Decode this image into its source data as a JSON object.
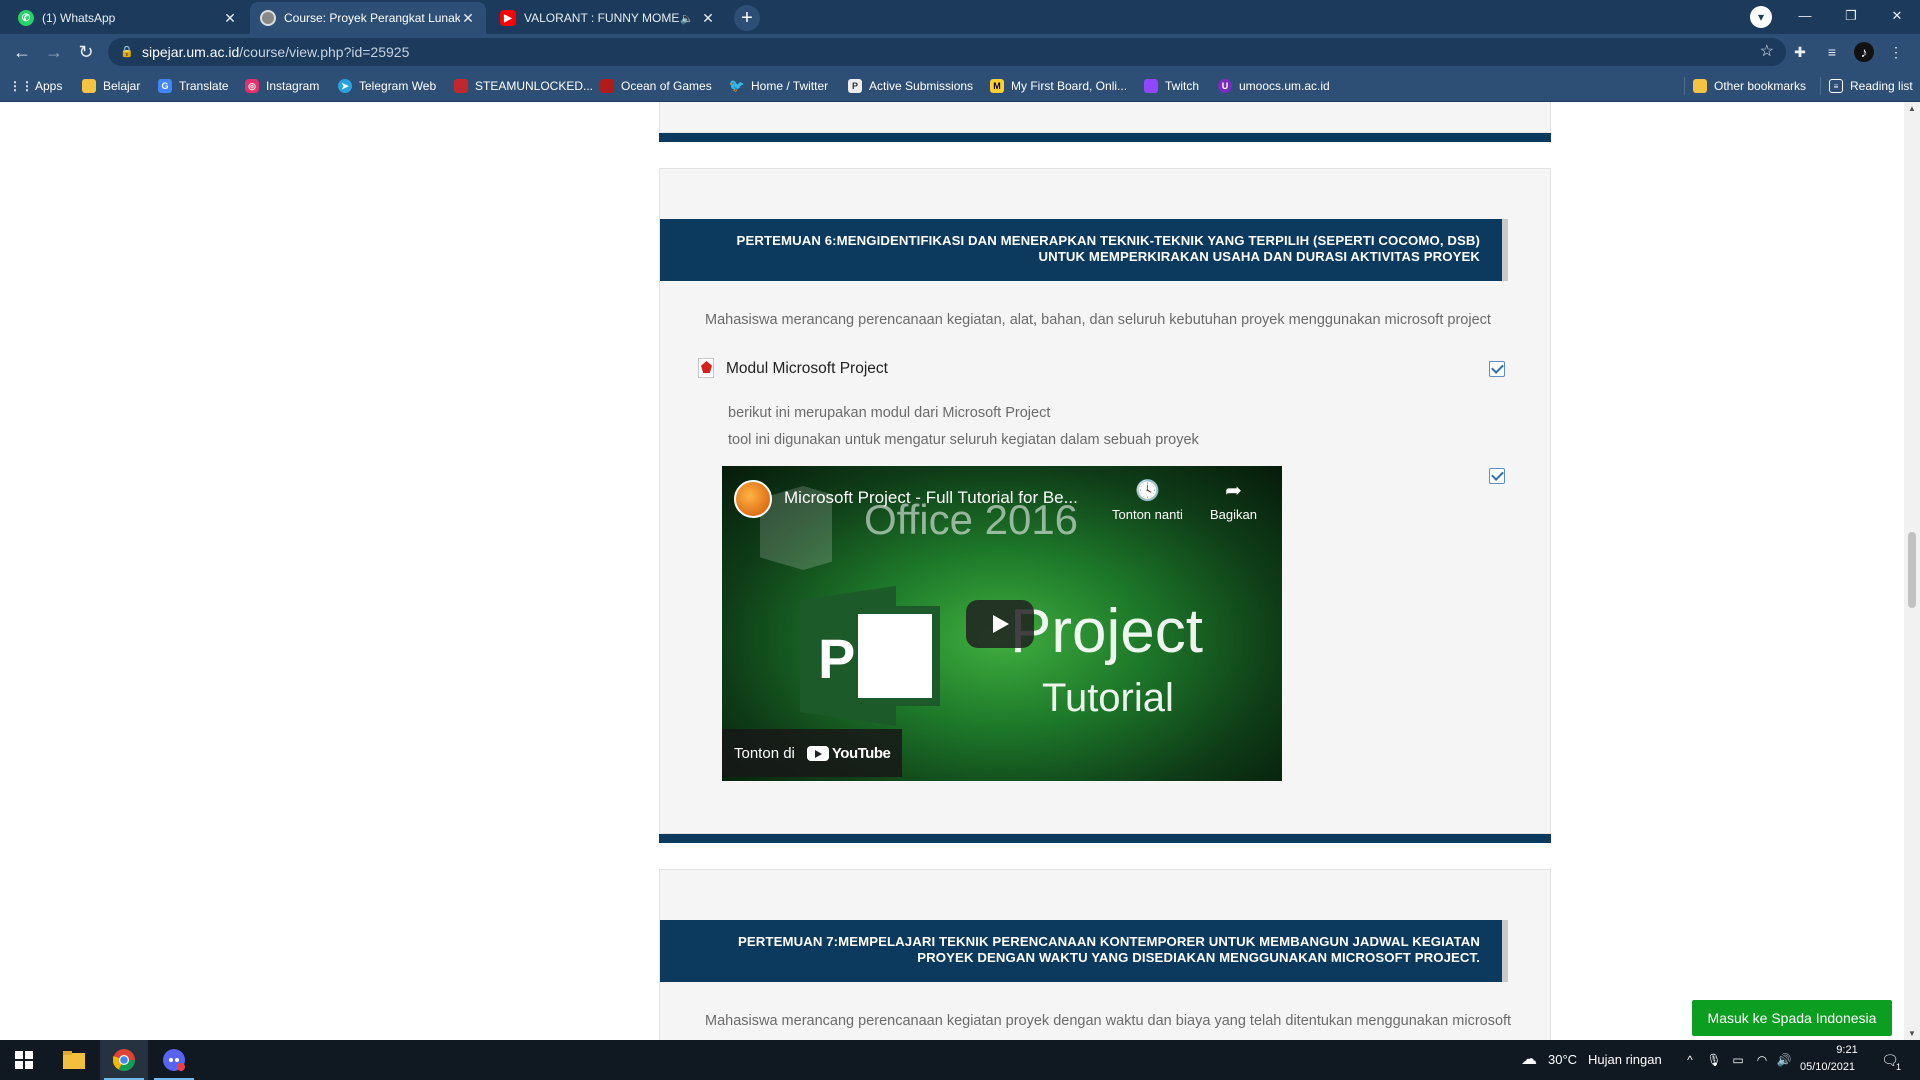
{
  "browser": {
    "tabs": [
      {
        "title": "(1) WhatsApp",
        "icon": "whatsapp-icon",
        "color": "#25d366"
      },
      {
        "title": "Course: Proyek Perangkat Lunak",
        "icon": "course-icon",
        "color": "#aaaaaa"
      },
      {
        "title": "VALORANT : FUNNY MOMEN",
        "icon": "youtube-icon",
        "color": "#ff0000"
      }
    ],
    "new_tab": "+",
    "address": {
      "host": "sipejar.um.ac.id",
      "path": "/course/view.php?id=25925"
    },
    "bookmarks": [
      {
        "label": "Apps",
        "icon": "apps-grid-icon",
        "color": "#4285f4"
      },
      {
        "label": "Belajar",
        "icon": "folder-icon",
        "color": "#f6c343"
      },
      {
        "label": "Translate",
        "icon": "translate-icon",
        "color": "#4285f4"
      },
      {
        "label": "Instagram",
        "icon": "instagram-icon",
        "color": "#e1306c"
      },
      {
        "label": "Telegram Web",
        "icon": "telegram-icon",
        "color": "#2aa3dd"
      },
      {
        "label": "STEAMUNLOCKED...",
        "icon": "steamunlocked-icon",
        "color": "#c0282d"
      },
      {
        "label": "Ocean of Games",
        "icon": "ocean-of-games-icon",
        "color": "#b31b1b"
      },
      {
        "label": "Home / Twitter",
        "icon": "twitter-icon",
        "color": "#1da1f2"
      },
      {
        "label": "Active Submissions",
        "icon": "submissions-icon",
        "color": "#555555"
      },
      {
        "label": "My First Board, Onli...",
        "icon": "miro-icon",
        "color": "#ffd02f"
      },
      {
        "label": "Twitch",
        "icon": "twitch-icon",
        "color": "#9146ff"
      },
      {
        "label": "umoocs.um.ac.id",
        "icon": "umoocs-icon",
        "color": "#7b2cbf"
      }
    ],
    "other_bookmarks": "Other bookmarks",
    "reading_list": "Reading list"
  },
  "page": {
    "section6": {
      "title_line1": "PERTEMUAN 6:MENGIDENTIFIKASI DAN MENERAPKAN TEKNIK-TEKNIK YANG TERPILIH (SEPERTI COCOMO, DSB)",
      "title_line2": "UNTUK MEMPERKIRAKAN USAHA DAN DURASI AKTIVITAS PROYEK",
      "summary": "Mahasiswa merancang perencanaan kegiatan, alat, bahan, dan seluruh kebutuhan proyek menggunakan microsoft project",
      "activity_name": "Modul Microsoft Project",
      "desc_line1": "berikut ini merupakan modul dari Microsoft Project",
      "desc_line2": "tool ini digunakan untuk mengatur seluruh kegiatan dalam sebuah proyek",
      "video": {
        "title": "Microsoft Project - Full Tutorial for Be...",
        "watch_later": "Tonton nanti",
        "share": "Bagikan",
        "watch_on": "Tonton di",
        "youtube": "YouTube",
        "thumb_office": "Office 2016",
        "thumb_project": "Project",
        "thumb_tutorial": "Tutorial",
        "thumb_letter": "P"
      }
    },
    "section7": {
      "title_line1": "PERTEMUAN 7:MEMPELAJARI TEKNIK PERENCANAAN KONTEMPORER UNTUK MEMBANGUN JADWAL KEGIATAN",
      "title_line2": "PROYEK DENGAN WAKTU YANG DISEDIAKAN MENGGUNAKAN MICROSOFT PROJECT.",
      "summary": "Mahasiswa merancang perencanaan kegiatan proyek dengan waktu dan biaya yang telah ditentukan menggunakan microsoft"
    },
    "spada_button": "Masuk ke Spada Indonesia"
  },
  "taskbar": {
    "weather_temp": "30°C",
    "weather_desc": "Hujan ringan",
    "time": "9:21",
    "date": "05/10/2021",
    "notification_count": "1"
  }
}
